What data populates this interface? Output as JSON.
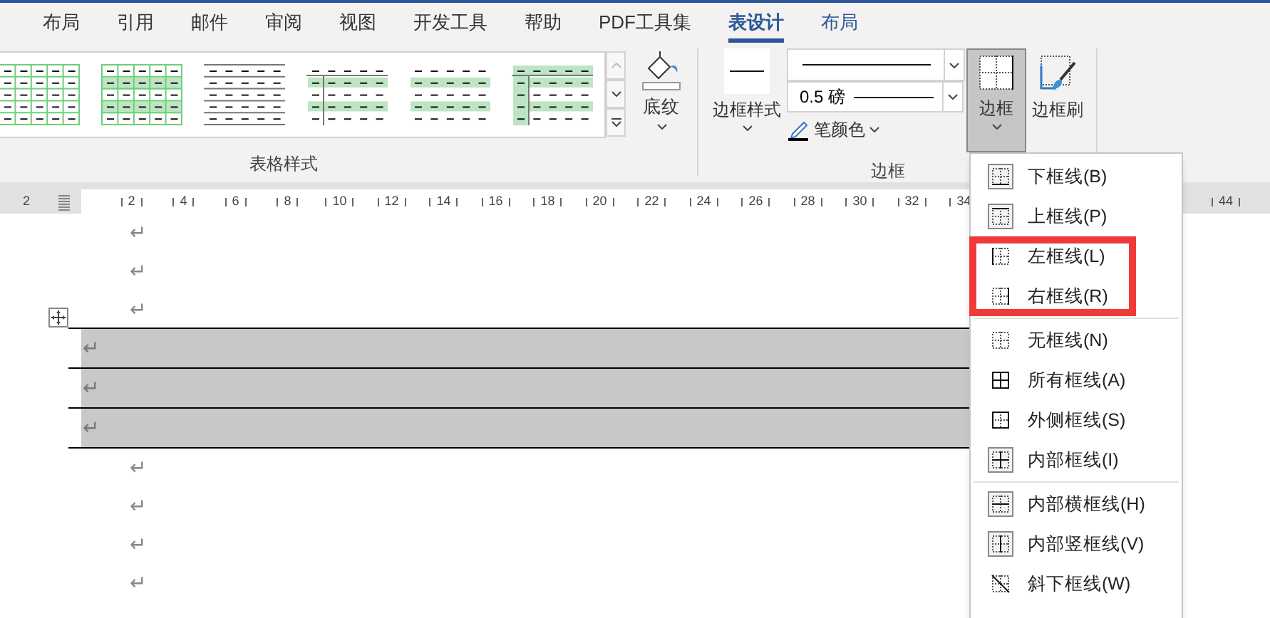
{
  "tabs": [
    {
      "label": "布局",
      "selected": false,
      "contextual": false
    },
    {
      "label": "引用",
      "selected": false,
      "contextual": false
    },
    {
      "label": "邮件",
      "selected": false,
      "contextual": false
    },
    {
      "label": "审阅",
      "selected": false,
      "contextual": false
    },
    {
      "label": "视图",
      "selected": false,
      "contextual": false
    },
    {
      "label": "开发工具",
      "selected": false,
      "contextual": false
    },
    {
      "label": "帮助",
      "selected": false,
      "contextual": false
    },
    {
      "label": "PDF工具集",
      "selected": false,
      "contextual": false
    },
    {
      "label": "表设计",
      "selected": true,
      "contextual": true
    },
    {
      "label": "布局",
      "selected": false,
      "contextual": true
    }
  ],
  "ribbon": {
    "table_styles": {
      "label": "表格样式"
    },
    "shading_button": {
      "label": "底纹"
    },
    "borders_group": {
      "label": "边框",
      "border_styles_button": {
        "label": "边框样式"
      },
      "line_weight": {
        "value": "0.5 磅"
      },
      "pen_color": {
        "label": "笔颜色"
      },
      "borders_button": {
        "label": "边框",
        "pressed": true
      },
      "border_painter": {
        "label": "边框刷"
      }
    }
  },
  "ruler": {
    "left_label": "2",
    "labels": [
      "2",
      "4",
      "6",
      "8",
      "10",
      "12",
      "14",
      "16",
      "18",
      "20",
      "22",
      "24",
      "26",
      "28",
      "30",
      "32",
      "34"
    ],
    "right_label": "44"
  },
  "document": {
    "lines": [
      {
        "kind": "paragraph",
        "mark": "↵"
      },
      {
        "kind": "paragraph",
        "mark": "↵"
      },
      {
        "kind": "paragraph",
        "mark": "↵",
        "table_handle": true
      },
      {
        "kind": "table_row",
        "mark": "↵"
      },
      {
        "kind": "table_row",
        "mark": "↵"
      },
      {
        "kind": "table_row",
        "mark": "↵"
      },
      {
        "kind": "paragraph",
        "mark": "↵"
      },
      {
        "kind": "paragraph",
        "mark": "↵"
      },
      {
        "kind": "paragraph",
        "mark": "↵"
      },
      {
        "kind": "paragraph",
        "mark": "↵"
      }
    ]
  },
  "border_menu": {
    "groups": [
      [
        {
          "label": "下框线(B)",
          "kind": "bottom",
          "highlighted": false
        },
        {
          "label": "上框线(P)",
          "kind": "top",
          "highlighted": false
        },
        {
          "label": "左框线(L)",
          "kind": "left",
          "highlighted": true
        },
        {
          "label": "右框线(R)",
          "kind": "right",
          "highlighted": true
        }
      ],
      [
        {
          "label": "无框线(N)",
          "kind": "none",
          "highlighted": false
        },
        {
          "label": "所有框线(A)",
          "kind": "all",
          "highlighted": false
        },
        {
          "label": "外侧框线(S)",
          "kind": "outside",
          "highlighted": false
        },
        {
          "label": "内部框线(I)",
          "kind": "inside",
          "highlighted": false
        }
      ],
      [
        {
          "label": "内部横框线(H)",
          "kind": "inside_h",
          "highlighted": false
        },
        {
          "label": "内部竖框线(V)",
          "kind": "inside_v",
          "highlighted": false
        },
        {
          "label": "斜下框线(W)",
          "kind": "diag_down",
          "highlighted": false
        }
      ]
    ]
  }
}
